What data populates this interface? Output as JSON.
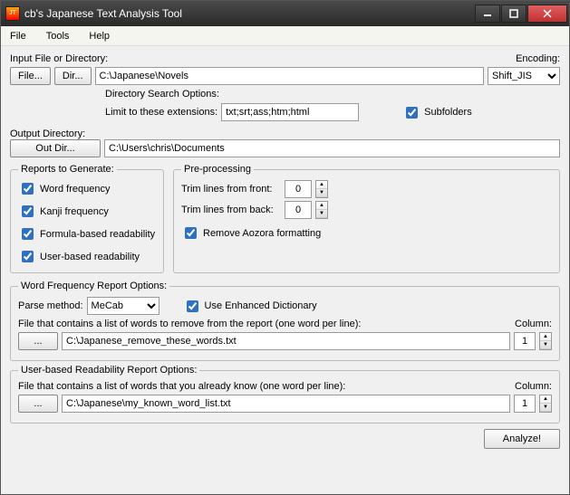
{
  "window": {
    "title": "cb's Japanese Text Analysis Tool"
  },
  "menu": {
    "file": "File",
    "tools": "Tools",
    "help": "Help"
  },
  "input": {
    "label": "Input File or Directory:",
    "file_btn": "File...",
    "dir_btn": "Dir...",
    "path": "C:\\Japanese\\Novels",
    "encoding_label": "Encoding:",
    "encoding": "Shift_JIS",
    "dso_label": "Directory Search Options:",
    "limit_label": "Limit to these extensions:",
    "extensions": "txt;srt;ass;htm;html",
    "subfolders": "Subfolders"
  },
  "output": {
    "label": "Output Directory:",
    "btn": "Out Dir...",
    "path": "C:\\Users\\chris\\Documents"
  },
  "reports": {
    "legend": "Reports to Generate:",
    "word_freq": "Word frequency",
    "kanji_freq": "Kanji frequency",
    "formula": "Formula-based readability",
    "user": "User-based readability"
  },
  "pre": {
    "legend": "Pre-processing",
    "front_label": "Trim lines from front:",
    "front_val": "0",
    "back_label": "Trim lines from back:",
    "back_val": "0",
    "aozora": "Remove Aozora formatting"
  },
  "wfr": {
    "legend": "Word Frequency Report Options:",
    "parse_label": "Parse method:",
    "parse_val": "MeCab",
    "enhanced": "Use Enhanced Dictionary",
    "remove_label": "File that contains a list of words to remove from the report (one word per line):",
    "remove_path": "C:\\Japanese_remove_these_words.txt",
    "column_label": "Column:",
    "column_val": "1",
    "browse": "..."
  },
  "ubr": {
    "legend": "User-based Readability Report Options:",
    "known_label": "File that contains a list of words that you already know (one word per line):",
    "known_path": "C:\\Japanese\\my_known_word_list.txt",
    "column_label": "Column:",
    "column_val": "1",
    "browse": "..."
  },
  "analyze": "Analyze!"
}
